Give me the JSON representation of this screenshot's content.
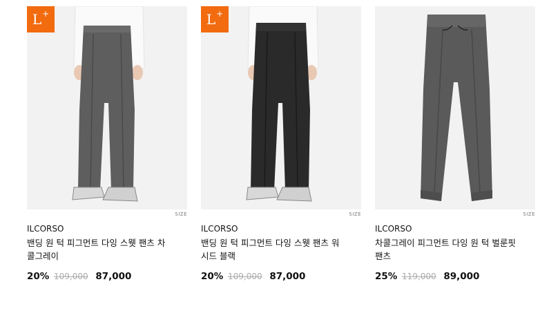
{
  "products": [
    {
      "badge": "L",
      "badge_sup": "+",
      "size_label": "SIZE",
      "brand": "ILCORSO",
      "name": "밴딩 원 턱 피그먼트 다잉 스웻 팬츠 차콜그레이",
      "discount": "20%",
      "original_price": "109,000",
      "price": "87,000",
      "pants_color": "#5e5e5e"
    },
    {
      "badge": "L",
      "badge_sup": "+",
      "size_label": "SIZE",
      "brand": "ILCORSO",
      "name": "밴딩 원 턱 피그먼트 다잉 스웻 팬츠 워시드 블랙",
      "discount": "20%",
      "original_price": "109,000",
      "price": "87,000",
      "pants_color": "#2a2a2a"
    },
    {
      "size_label": "SIZE",
      "brand": "ILCORSO",
      "name": "차콜그레이 피그먼트 다잉 원 턱 벌룬핏 팬츠",
      "discount": "25%",
      "original_price": "119,000",
      "price": "89,000",
      "pants_color": "#5a5a5a"
    }
  ],
  "colors": {
    "badge_orange": "#f26b0f",
    "thumb_bg": "#f2f2f2"
  }
}
